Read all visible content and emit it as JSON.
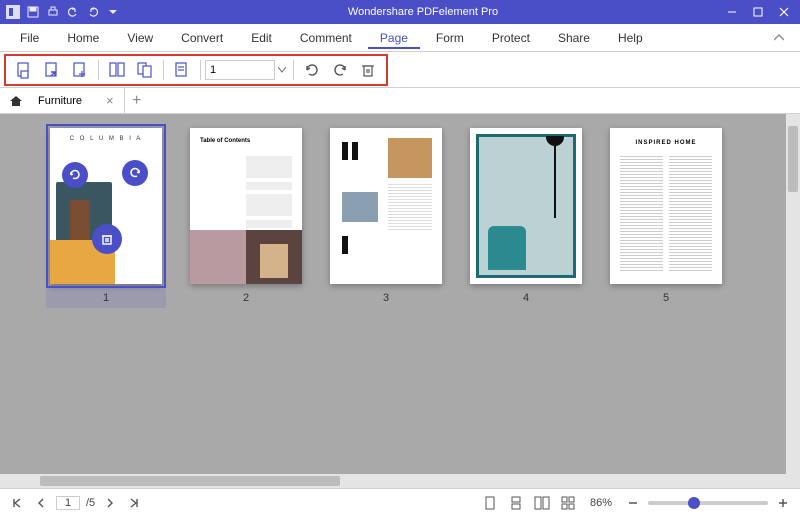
{
  "titlebar": {
    "app_title": "Wondershare PDFelement Pro",
    "qat": {
      "logo": "logo",
      "save": "save",
      "print": "print",
      "undo": "undo",
      "redo": "redo",
      "more": "more"
    }
  },
  "menu": {
    "items": [
      "File",
      "Home",
      "View",
      "Convert",
      "Edit",
      "Comment",
      "Page",
      "Form",
      "Protect",
      "Share",
      "Help"
    ],
    "active_index": 6
  },
  "toolbar": {
    "page_value": "1"
  },
  "tabs": {
    "doc_name": "Furniture",
    "close": "×",
    "add": "+"
  },
  "thumbs": {
    "labels": [
      "1",
      "2",
      "3",
      "4",
      "5"
    ],
    "selected_index": 0,
    "page1_title": "C O L U M B I A",
    "page2_title": "Table of Contents",
    "page5_title": "INSPIRED HOME"
  },
  "statusbar": {
    "page_current": "1",
    "page_total": "/5",
    "zoom_pct": "86%"
  }
}
